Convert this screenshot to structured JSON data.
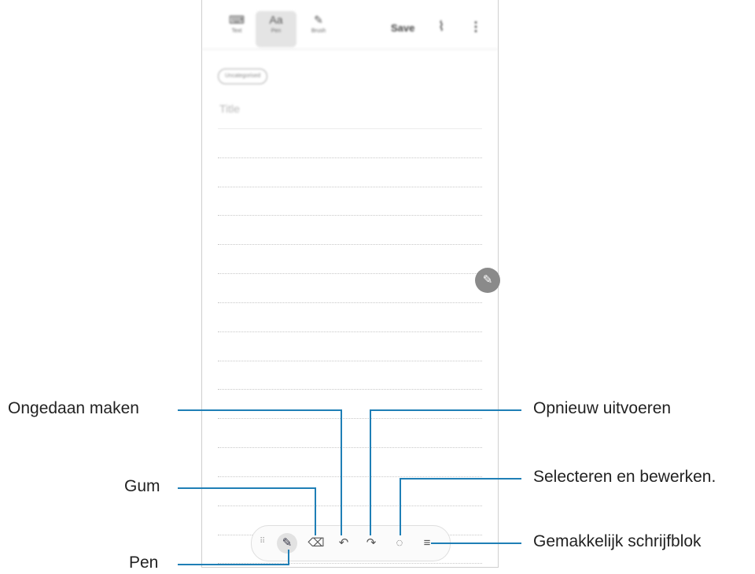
{
  "top_bar": {
    "tabs": [
      {
        "label": "Text",
        "icon": "keyboard-icon"
      },
      {
        "label": "Pen",
        "icon": "handwriting-icon"
      },
      {
        "label": "Brush",
        "icon": "brush-icon"
      }
    ],
    "save_label": "Save"
  },
  "note": {
    "category_chip": "Uncategorised",
    "title_placeholder": "Title"
  },
  "callouts": {
    "undo": "Ongedaan maken",
    "redo": "Opnieuw uitvoeren",
    "eraser": "Gum",
    "select": "Selecteren en bewerken.",
    "pen": "Pen",
    "easy_writing_pad": "Gemakkelijk schrijfblok"
  },
  "accent_color": "#1f7fb6"
}
